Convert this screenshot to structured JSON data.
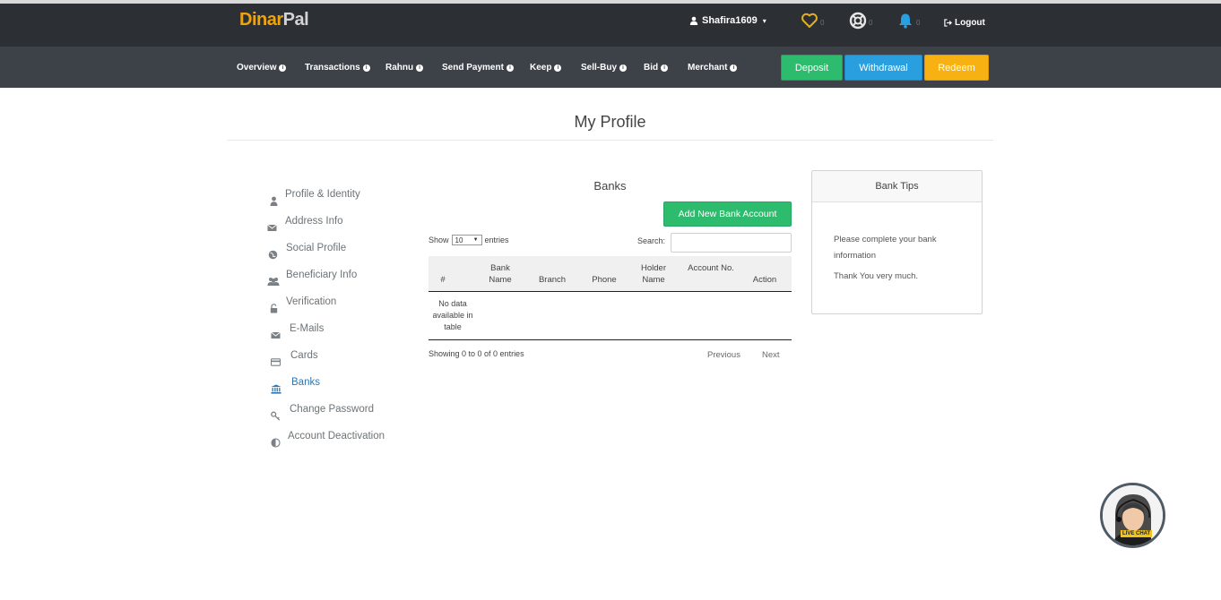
{
  "brand": {
    "part1": "Dinar",
    "part2": "Pal"
  },
  "header": {
    "username": "Shafira1609",
    "favorites_count": "0",
    "support_count": "0",
    "notifications_count": "0",
    "logout_label": "Logout"
  },
  "nav": {
    "items": [
      {
        "label": "Overview"
      },
      {
        "label": "Transactions"
      },
      {
        "label": "Rahnu"
      },
      {
        "label": "Send Payment"
      },
      {
        "label": "Keep"
      },
      {
        "label": "Sell-Buy"
      },
      {
        "label": "Bid"
      },
      {
        "label": "Merchant"
      }
    ],
    "info_glyph": "i",
    "deposit_label": "Deposit",
    "withdrawal_label": "Withdrawal",
    "redeem_label": "Redeem"
  },
  "page": {
    "title": "My Profile"
  },
  "sidebar": {
    "items": [
      {
        "label": "Profile & Identity",
        "icon": "user-icon"
      },
      {
        "label": "Address Info",
        "icon": "envelope-icon"
      },
      {
        "label": "Social Profile",
        "icon": "globe-icon"
      },
      {
        "label": "Beneficiary Info",
        "icon": "users-icon"
      },
      {
        "label": "Verification",
        "icon": "lock-icon"
      },
      {
        "label": "E-Mails",
        "icon": "envelope-icon"
      },
      {
        "label": "Cards",
        "icon": "credit-card-icon"
      },
      {
        "label": "Banks",
        "icon": "bank-icon",
        "active": true
      },
      {
        "label": "Change Password",
        "icon": "key-icon"
      },
      {
        "label": "Account Deactivation",
        "icon": "half-circle-icon"
      }
    ],
    "active_color": "#2f77b3"
  },
  "banks": {
    "title": "Banks",
    "add_button": "Add New Bank Account",
    "show_label": "Show",
    "page_size": "10",
    "entries_label": "entries",
    "search_label": "Search:",
    "search_value": "",
    "columns": [
      "#",
      "Bank Name",
      "Branch",
      "Phone",
      "Holder Name",
      "Account No.",
      "Action"
    ],
    "empty_text": "No data available in table",
    "info_text": "Showing 0 to 0 of 0 entries",
    "prev_label": "Previous",
    "next_label": "Next"
  },
  "tips": {
    "title": "Bank Tips",
    "line1": "Please complete your bank information",
    "line2": "Thank You very much."
  },
  "livechat": {
    "label": "LIVE CHAT"
  },
  "colors": {
    "topbar": "#2c3035",
    "navbar": "#3d4249",
    "deposit": "#2dbc6d",
    "withdrawal": "#2a9fe0",
    "redeem": "#f7b112",
    "brand_accent": "#f0a30a"
  }
}
